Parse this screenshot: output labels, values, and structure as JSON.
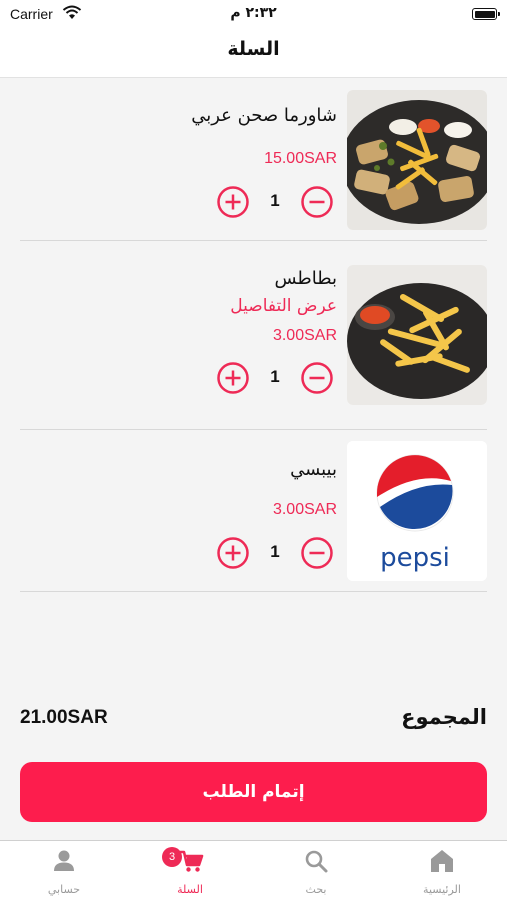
{
  "status_bar": {
    "carrier": "Carrier",
    "time": "٢:٣٢ م"
  },
  "header": {
    "title": "السلة"
  },
  "cart": {
    "items": [
      {
        "name": "شاورما صحن عربي",
        "price": "15.00SAR",
        "quantity": "1",
        "details_link": ""
      },
      {
        "name": "بطاطس",
        "price": "3.00SAR",
        "quantity": "1",
        "details_link": "عرض التفاصيل"
      },
      {
        "name": "بيبسي",
        "price": "3.00SAR",
        "quantity": "1",
        "details_link": ""
      }
    ],
    "pepsi_logo_text": "pepsi"
  },
  "summary": {
    "total_label": "المجموع",
    "total_value": "21.00SAR"
  },
  "checkout": {
    "label": "إتمام الطلب"
  },
  "tab_bar": {
    "cart_badge": "3",
    "tabs": [
      {
        "label": "حسابي",
        "icon": "person-icon"
      },
      {
        "label": "السلة",
        "icon": "cart-icon"
      },
      {
        "label": "بحث",
        "icon": "search-icon"
      },
      {
        "label": "الرئيسية",
        "icon": "home-icon"
      }
    ]
  },
  "colors": {
    "accent": "#fd1d4d",
    "price": "#ee2a56",
    "background": "#f4f4f4"
  }
}
